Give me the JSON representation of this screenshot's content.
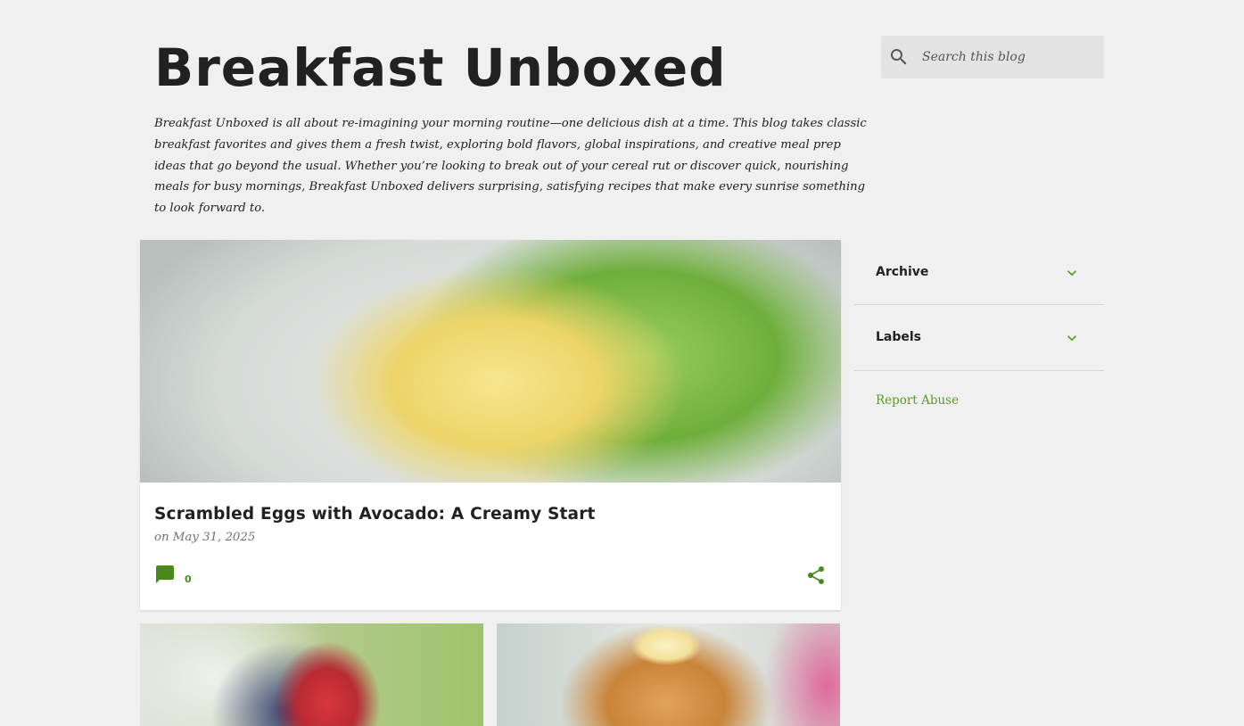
{
  "header": {
    "title": "Breakfast Unboxed",
    "description": "Breakfast Unboxed is all about re-imagining your morning routine—one delicious dish at a time. This blog takes classic breakfast favorites and gives them a fresh twist, exploring bold flavors, global inspirations, and creative meal prep ideas that go beyond the usual. Whether you’re looking to break out of your cereal rut or discover quick, nourishing meals for busy mornings, Breakfast Unboxed delivers surprising, satisfying recipes that make every sunrise something to look forward to."
  },
  "search": {
    "placeholder": "Search this blog",
    "icon": "search-icon"
  },
  "featured_post": {
    "title": "Scrambled Eggs with Avocado: A Creamy Start",
    "date": "on May 31, 2025",
    "comment_count": "0",
    "comment_icon": "comment-icon",
    "share_icon": "share-icon"
  },
  "sidebar": {
    "widgets": [
      {
        "title": "Archive",
        "icon": "chevron-down-icon"
      },
      {
        "title": "Labels",
        "icon": "chevron-down-icon"
      }
    ],
    "report_abuse": "Report Abuse"
  },
  "colors": {
    "background": "#f0f0f0",
    "link_green": "#5d9a24",
    "icon_green": "#4a8a1a"
  }
}
